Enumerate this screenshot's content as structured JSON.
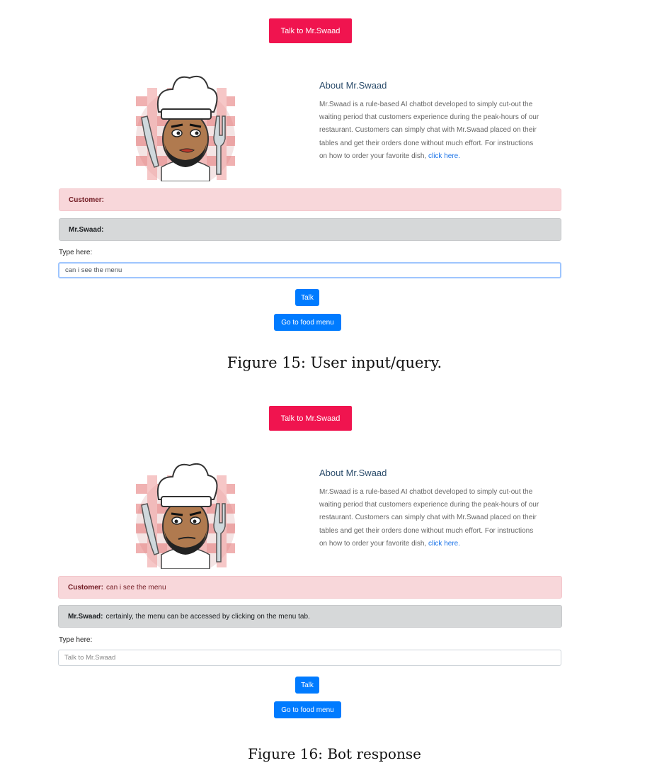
{
  "top_button_label": "Talk to Mr.Swaad",
  "about": {
    "title": "About Mr.Swaad",
    "text": "Mr.Swaad is a rule-based AI chatbot developed to simply cut-out the waiting period that customers experience during the peak-hours of our restaurant. Customers can simply chat with Mr.Swaad placed on their tables and get their orders done without much effort. For instructions on how to order your favorite dish, ",
    "link": "click here."
  },
  "panel1": {
    "customer_label": "Customer:",
    "customer_message": "",
    "bot_label": "Mr.Swaad:",
    "bot_message": "",
    "type_label": "Type here:",
    "input_value": "can i see the menu",
    "input_placeholder": "Talk to Mr.Swaad",
    "talk_label": "Talk",
    "menu_label": "Go to food menu"
  },
  "caption1": "Figure 15: User input/query.",
  "panel2": {
    "customer_label": "Customer:",
    "customer_message": "can i see the menu",
    "bot_label": "Mr.Swaad:",
    "bot_message": "certainly, the menu can be accessed by clicking on the menu tab.",
    "type_label": "Type here:",
    "input_value": "",
    "input_placeholder": "Talk to Mr.Swaad",
    "talk_label": "Talk",
    "menu_label": "Go to food menu"
  },
  "caption2": "Figure 16: Bot response",
  "colors": {
    "accent_button": "#f0144f",
    "primary_button": "#007bff",
    "customer_bar": "#f8d7da",
    "bot_bar": "#d6d8d9",
    "link": "#1a73e8"
  },
  "icons": [
    "chef-avatar-icon"
  ]
}
